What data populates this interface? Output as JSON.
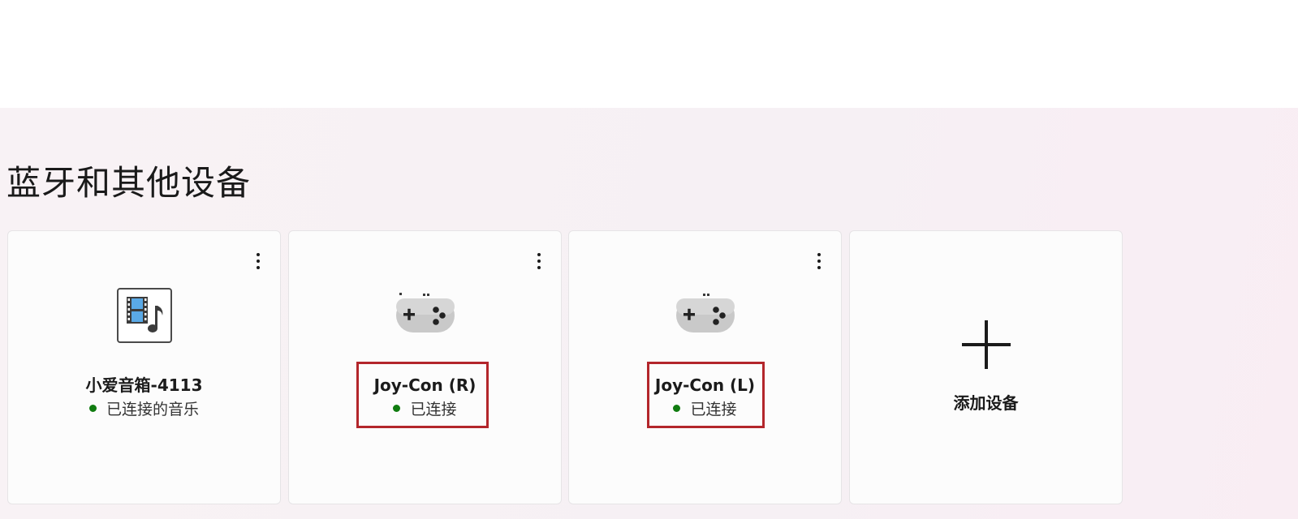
{
  "section": {
    "title": "蓝牙和其他设备"
  },
  "devices": [
    {
      "name": "小爱音箱-4113",
      "status": "已连接的音乐",
      "icon": "media-speaker-icon",
      "status_color": "#107c10",
      "highlighted": false
    },
    {
      "name": "Joy-Con (R)",
      "status": "已连接",
      "icon": "gamepad-icon",
      "status_color": "#107c10",
      "highlighted": true
    },
    {
      "name": "Joy-Con (L)",
      "status": "已连接",
      "icon": "gamepad-icon",
      "status_color": "#107c10",
      "highlighted": true
    }
  ],
  "add_device": {
    "label": "添加设备",
    "icon": "plus-icon"
  },
  "colors": {
    "connected": "#107c10",
    "highlight": "#b3262b"
  }
}
